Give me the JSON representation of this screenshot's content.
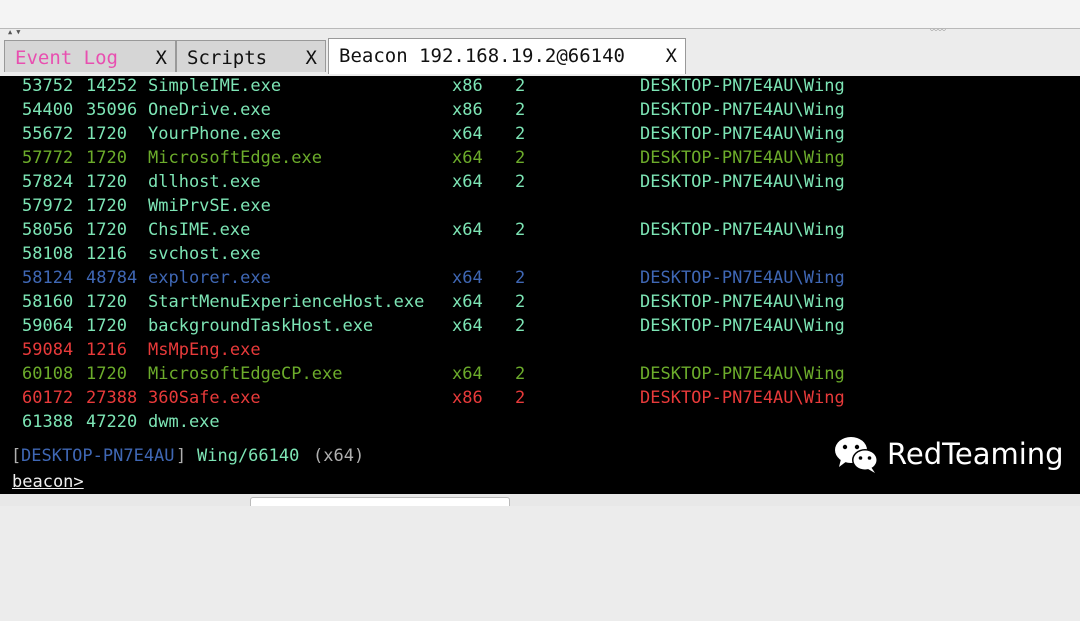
{
  "window": {
    "tabs": [
      {
        "label": "Event Log",
        "close": "X",
        "color": "#e84fb0"
      },
      {
        "label": "Scripts",
        "close": "X",
        "color": "#111111"
      },
      {
        "label": "Beacon 192.168.19.2@66140",
        "close": "X",
        "color": "#111111"
      }
    ],
    "active_tab": 2
  },
  "processes": [
    {
      "pid": "53752",
      "ppid": "14252",
      "name": "SimpleIME.exe",
      "arch": "x86",
      "session": "2",
      "user": "DESKTOP-PN7E4AU\\Wing",
      "tone": "green"
    },
    {
      "pid": "54400",
      "ppid": "35096",
      "name": "OneDrive.exe",
      "arch": "x86",
      "session": "2",
      "user": "DESKTOP-PN7E4AU\\Wing",
      "tone": "green"
    },
    {
      "pid": "55672",
      "ppid": "1720",
      "name": "YourPhone.exe",
      "arch": "x64",
      "session": "2",
      "user": "DESKTOP-PN7E4AU\\Wing",
      "tone": "green"
    },
    {
      "pid": "57772",
      "ppid": "1720",
      "name": "MicrosoftEdge.exe",
      "arch": "x64",
      "session": "2",
      "user": "DESKTOP-PN7E4AU\\Wing",
      "tone": "olive"
    },
    {
      "pid": "57824",
      "ppid": "1720",
      "name": "dllhost.exe",
      "arch": "x64",
      "session": "2",
      "user": "DESKTOP-PN7E4AU\\Wing",
      "tone": "green"
    },
    {
      "pid": "57972",
      "ppid": "1720",
      "name": "WmiPrvSE.exe",
      "arch": "",
      "session": "",
      "user": "",
      "tone": "green"
    },
    {
      "pid": "58056",
      "ppid": "1720",
      "name": "ChsIME.exe",
      "arch": "x64",
      "session": "2",
      "user": "DESKTOP-PN7E4AU\\Wing",
      "tone": "green"
    },
    {
      "pid": "58108",
      "ppid": "1216",
      "name": "svchost.exe",
      "arch": "",
      "session": "",
      "user": "",
      "tone": "green"
    },
    {
      "pid": "58124",
      "ppid": "48784",
      "name": "explorer.exe",
      "arch": "x64",
      "session": "2",
      "user": "DESKTOP-PN7E4AU\\Wing",
      "tone": "blue"
    },
    {
      "pid": "58160",
      "ppid": "1720",
      "name": "StartMenuExperienceHost.exe",
      "arch": "x64",
      "session": "2",
      "user": "DESKTOP-PN7E4AU\\Wing",
      "tone": "green"
    },
    {
      "pid": "59064",
      "ppid": "1720",
      "name": "backgroundTaskHost.exe",
      "arch": "x64",
      "session": "2",
      "user": "DESKTOP-PN7E4AU\\Wing",
      "tone": "green"
    },
    {
      "pid": "59084",
      "ppid": "1216",
      "name": "MsMpEng.exe",
      "arch": "",
      "session": "",
      "user": "",
      "tone": "red"
    },
    {
      "pid": "60108",
      "ppid": "1720",
      "name": "MicrosoftEdgeCP.exe",
      "arch": "x64",
      "session": "2",
      "user": "DESKTOP-PN7E4AU\\Wing",
      "tone": "olive"
    },
    {
      "pid": "60172",
      "ppid": "27388",
      "name": "360Safe.exe",
      "arch": "x86",
      "session": "2",
      "user": "DESKTOP-PN7E4AU\\Wing",
      "tone": "red"
    },
    {
      "pid": "61388",
      "ppid": "47220",
      "name": "dwm.exe",
      "arch": "",
      "session": "",
      "user": "",
      "tone": "green"
    }
  ],
  "status": {
    "open_bracket": "[",
    "host": "DESKTOP-PN7E4AU",
    "close_bracket": "]",
    "user_pid": "Wing/66140",
    "arch": "(x64)"
  },
  "prompt": {
    "label": "beacon",
    "symbol": ">"
  },
  "watermark": {
    "text": "RedTeaming",
    "icon": "wechat-icon"
  },
  "colors": {
    "green": "#7de5b5",
    "olive": "#6cac2b",
    "blue": "#3f67b4",
    "red": "#e83a3a",
    "status_host": "#3f67b4",
    "status_user": "#7de5b5",
    "status_arch": "#b0b0b0"
  }
}
